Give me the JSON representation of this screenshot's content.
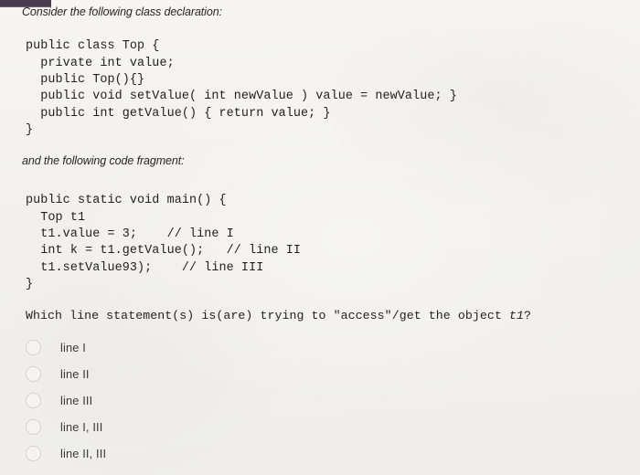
{
  "document": {
    "prompt_1": "Consider the following class declaration:",
    "prompt_2": "and the following code fragment:",
    "class_declaration": "public class Top {\n  private int value;\n  public Top(){}\n  public void setValue( int newValue ) value = newValue; }\n  public int getValue() { return value; }\n}",
    "code_fragment": "public static void main() {\n  Top t1\n  t1.value = 3;    // line I\n  int k = t1.getValue();   // line II\n  t1.setValue93);    // line III\n}",
    "question_prefix": "Which line statement(s) is(are) trying to \"access\"/get the object ",
    "question_object": "t1",
    "question_suffix": "?",
    "options": [
      {
        "label": "line I",
        "selected": false
      },
      {
        "label": "line II",
        "selected": false
      },
      {
        "label": "line III",
        "selected": false
      },
      {
        "label": "line I, III",
        "selected": false
      },
      {
        "label": "line II, III",
        "selected": false
      }
    ]
  },
  "colors": {
    "paper": "#f3f2ef",
    "text": "#1f1f1f",
    "radio_outline": "#d2d0cb",
    "top_bar": "#4a3b4f"
  }
}
